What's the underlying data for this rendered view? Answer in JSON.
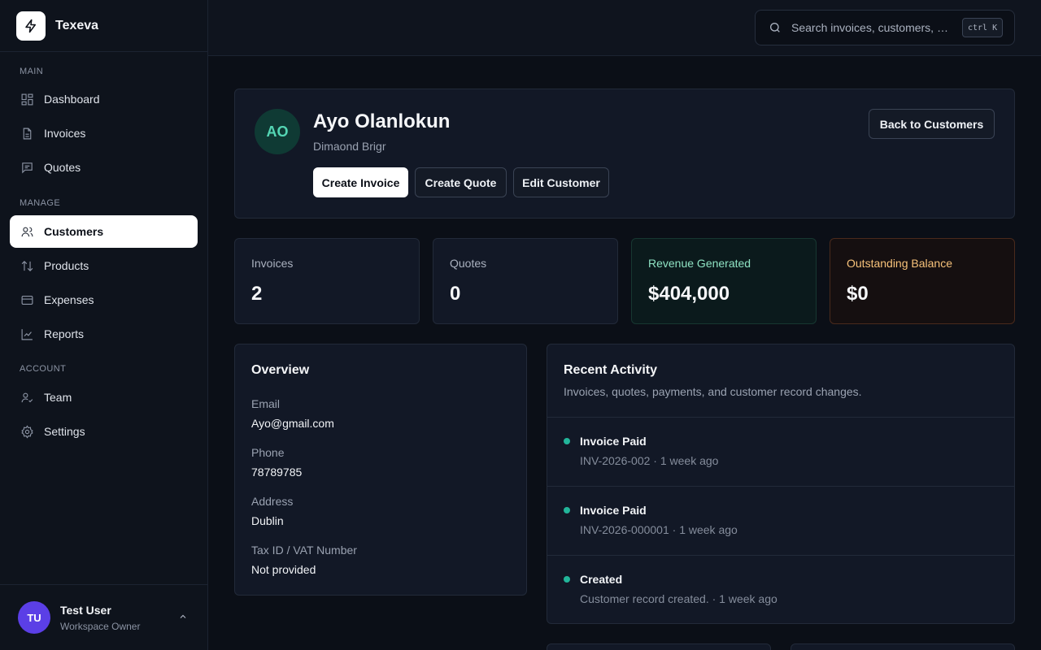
{
  "brand": {
    "name": "Texeva"
  },
  "sidebar": {
    "sections": [
      {
        "heading": "MAIN",
        "items": [
          {
            "label": "Dashboard",
            "icon": "grid-icon"
          },
          {
            "label": "Invoices",
            "icon": "file-icon"
          },
          {
            "label": "Quotes",
            "icon": "message-icon"
          }
        ]
      },
      {
        "heading": "MANAGE",
        "items": [
          {
            "label": "Customers",
            "icon": "users-icon",
            "active": true
          },
          {
            "label": "Products",
            "icon": "arrows-icon"
          },
          {
            "label": "Expenses",
            "icon": "card-icon"
          },
          {
            "label": "Reports",
            "icon": "chart-icon"
          }
        ]
      },
      {
        "heading": "ACCOUNT",
        "items": [
          {
            "label": "Team",
            "icon": "user-check-icon"
          },
          {
            "label": "Settings",
            "icon": "gear-icon"
          }
        ]
      }
    ]
  },
  "user": {
    "initials": "TU",
    "name": "Test User",
    "role": "Workspace Owner"
  },
  "search": {
    "placeholder": "Search invoices, customers, q...",
    "shortcut": "ctrl K"
  },
  "customer": {
    "initials": "AO",
    "name": "Ayo Olanlokun",
    "company": "Dimaond Brigr",
    "actions": {
      "create_invoice": "Create Invoice",
      "create_quote": "Create Quote",
      "edit_customer": "Edit Customer",
      "back": "Back to Customers"
    }
  },
  "stats": [
    {
      "label": "Invoices",
      "value": "2"
    },
    {
      "label": "Quotes",
      "value": "0"
    },
    {
      "label": "Revenue Generated",
      "value": "$404,000"
    },
    {
      "label": "Outstanding Balance",
      "value": "$0"
    }
  ],
  "overview": {
    "title": "Overview",
    "fields": [
      {
        "label": "Email",
        "value": "Ayo@gmail.com"
      },
      {
        "label": "Phone",
        "value": "78789785"
      },
      {
        "label": "Address",
        "value": "Dublin"
      },
      {
        "label": "Tax ID / VAT Number",
        "value": "Not provided"
      }
    ]
  },
  "activity": {
    "title": "Recent Activity",
    "subtitle": "Invoices, quotes, payments, and customer record changes.",
    "items": [
      {
        "name": "Invoice Paid",
        "meta": "INV-2026-002 · 1 week ago"
      },
      {
        "name": "Invoice Paid",
        "meta": "INV-2026-000001 · 1 week ago"
      },
      {
        "name": "Created",
        "meta": "Customer record created. · 1 week ago"
      }
    ]
  },
  "colors": {
    "accent": "#22b59a",
    "avatar_user": "#5b3fe6",
    "revenue": "#8fe3c3",
    "outstanding": "#f7c27a"
  }
}
